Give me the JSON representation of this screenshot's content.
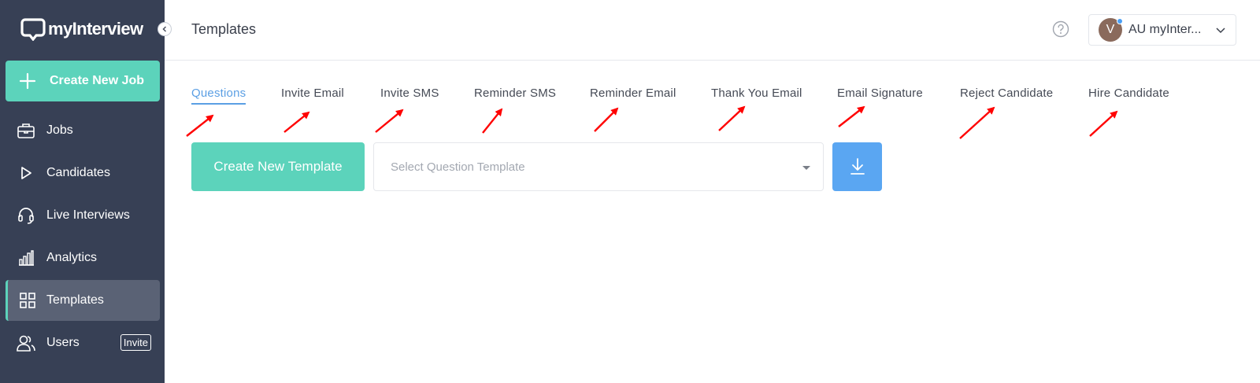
{
  "sidebar": {
    "logo_text": "myInterview",
    "create_job_label": "Create New Job",
    "items": [
      {
        "label": "Jobs",
        "icon": "briefcase-icon"
      },
      {
        "label": "Candidates",
        "icon": "play-icon"
      },
      {
        "label": "Live Interviews",
        "icon": "headset-icon"
      },
      {
        "label": "Analytics",
        "icon": "bar-chart-icon"
      },
      {
        "label": "Templates",
        "icon": "grid-icon",
        "active": true
      },
      {
        "label": "Users",
        "icon": "users-icon",
        "badge": "Invite"
      }
    ]
  },
  "header": {
    "title": "Templates",
    "user": {
      "initial": "V",
      "name": "AU myInter..."
    }
  },
  "tabs": [
    {
      "label": "Questions",
      "active": true
    },
    {
      "label": "Invite Email"
    },
    {
      "label": "Invite SMS"
    },
    {
      "label": "Reminder SMS"
    },
    {
      "label": "Reminder Email"
    },
    {
      "label": "Thank You Email"
    },
    {
      "label": "Email Signature"
    },
    {
      "label": "Reject Candidate"
    },
    {
      "label": "Hire Candidate"
    }
  ],
  "controls": {
    "create_template_label": "Create New Template",
    "select_placeholder": "Select Question Template"
  },
  "colors": {
    "sidebar_bg": "#374055",
    "accent_teal": "#5cd3bb",
    "accent_blue": "#5aa6f2",
    "tab_active": "#5b9fe4",
    "annotation_arrow": "#ff0000"
  }
}
